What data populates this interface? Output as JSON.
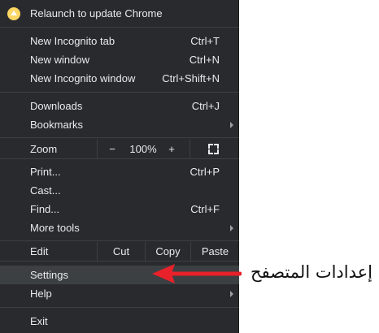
{
  "menu": {
    "relaunch_label": "Relaunch to update Chrome",
    "new_incognito_tab": {
      "label": "New Incognito tab",
      "shortcut": "Ctrl+T"
    },
    "new_window": {
      "label": "New window",
      "shortcut": "Ctrl+N"
    },
    "new_incognito_window": {
      "label": "New Incognito window",
      "shortcut": "Ctrl+Shift+N"
    },
    "downloads": {
      "label": "Downloads",
      "shortcut": "Ctrl+J"
    },
    "bookmarks": {
      "label": "Bookmarks"
    },
    "zoom": {
      "label": "Zoom",
      "minus": "−",
      "value": "100%",
      "plus": "+"
    },
    "print": {
      "label": "Print...",
      "shortcut": "Ctrl+P"
    },
    "cast": {
      "label": "Cast..."
    },
    "find": {
      "label": "Find...",
      "shortcut": "Ctrl+F"
    },
    "more_tools": {
      "label": "More tools"
    },
    "edit": {
      "label": "Edit",
      "cut": "Cut",
      "copy": "Copy",
      "paste": "Paste"
    },
    "settings": {
      "label": "Settings"
    },
    "help": {
      "label": "Help"
    },
    "exit": {
      "label": "Exit"
    }
  },
  "annotation": {
    "text": "إعدادات المتصفح",
    "arrow_color": "#e8212a"
  },
  "colors": {
    "menu_bg": "#292a2d",
    "highlight": "#3c4043",
    "update_badge": "#fdd663"
  }
}
